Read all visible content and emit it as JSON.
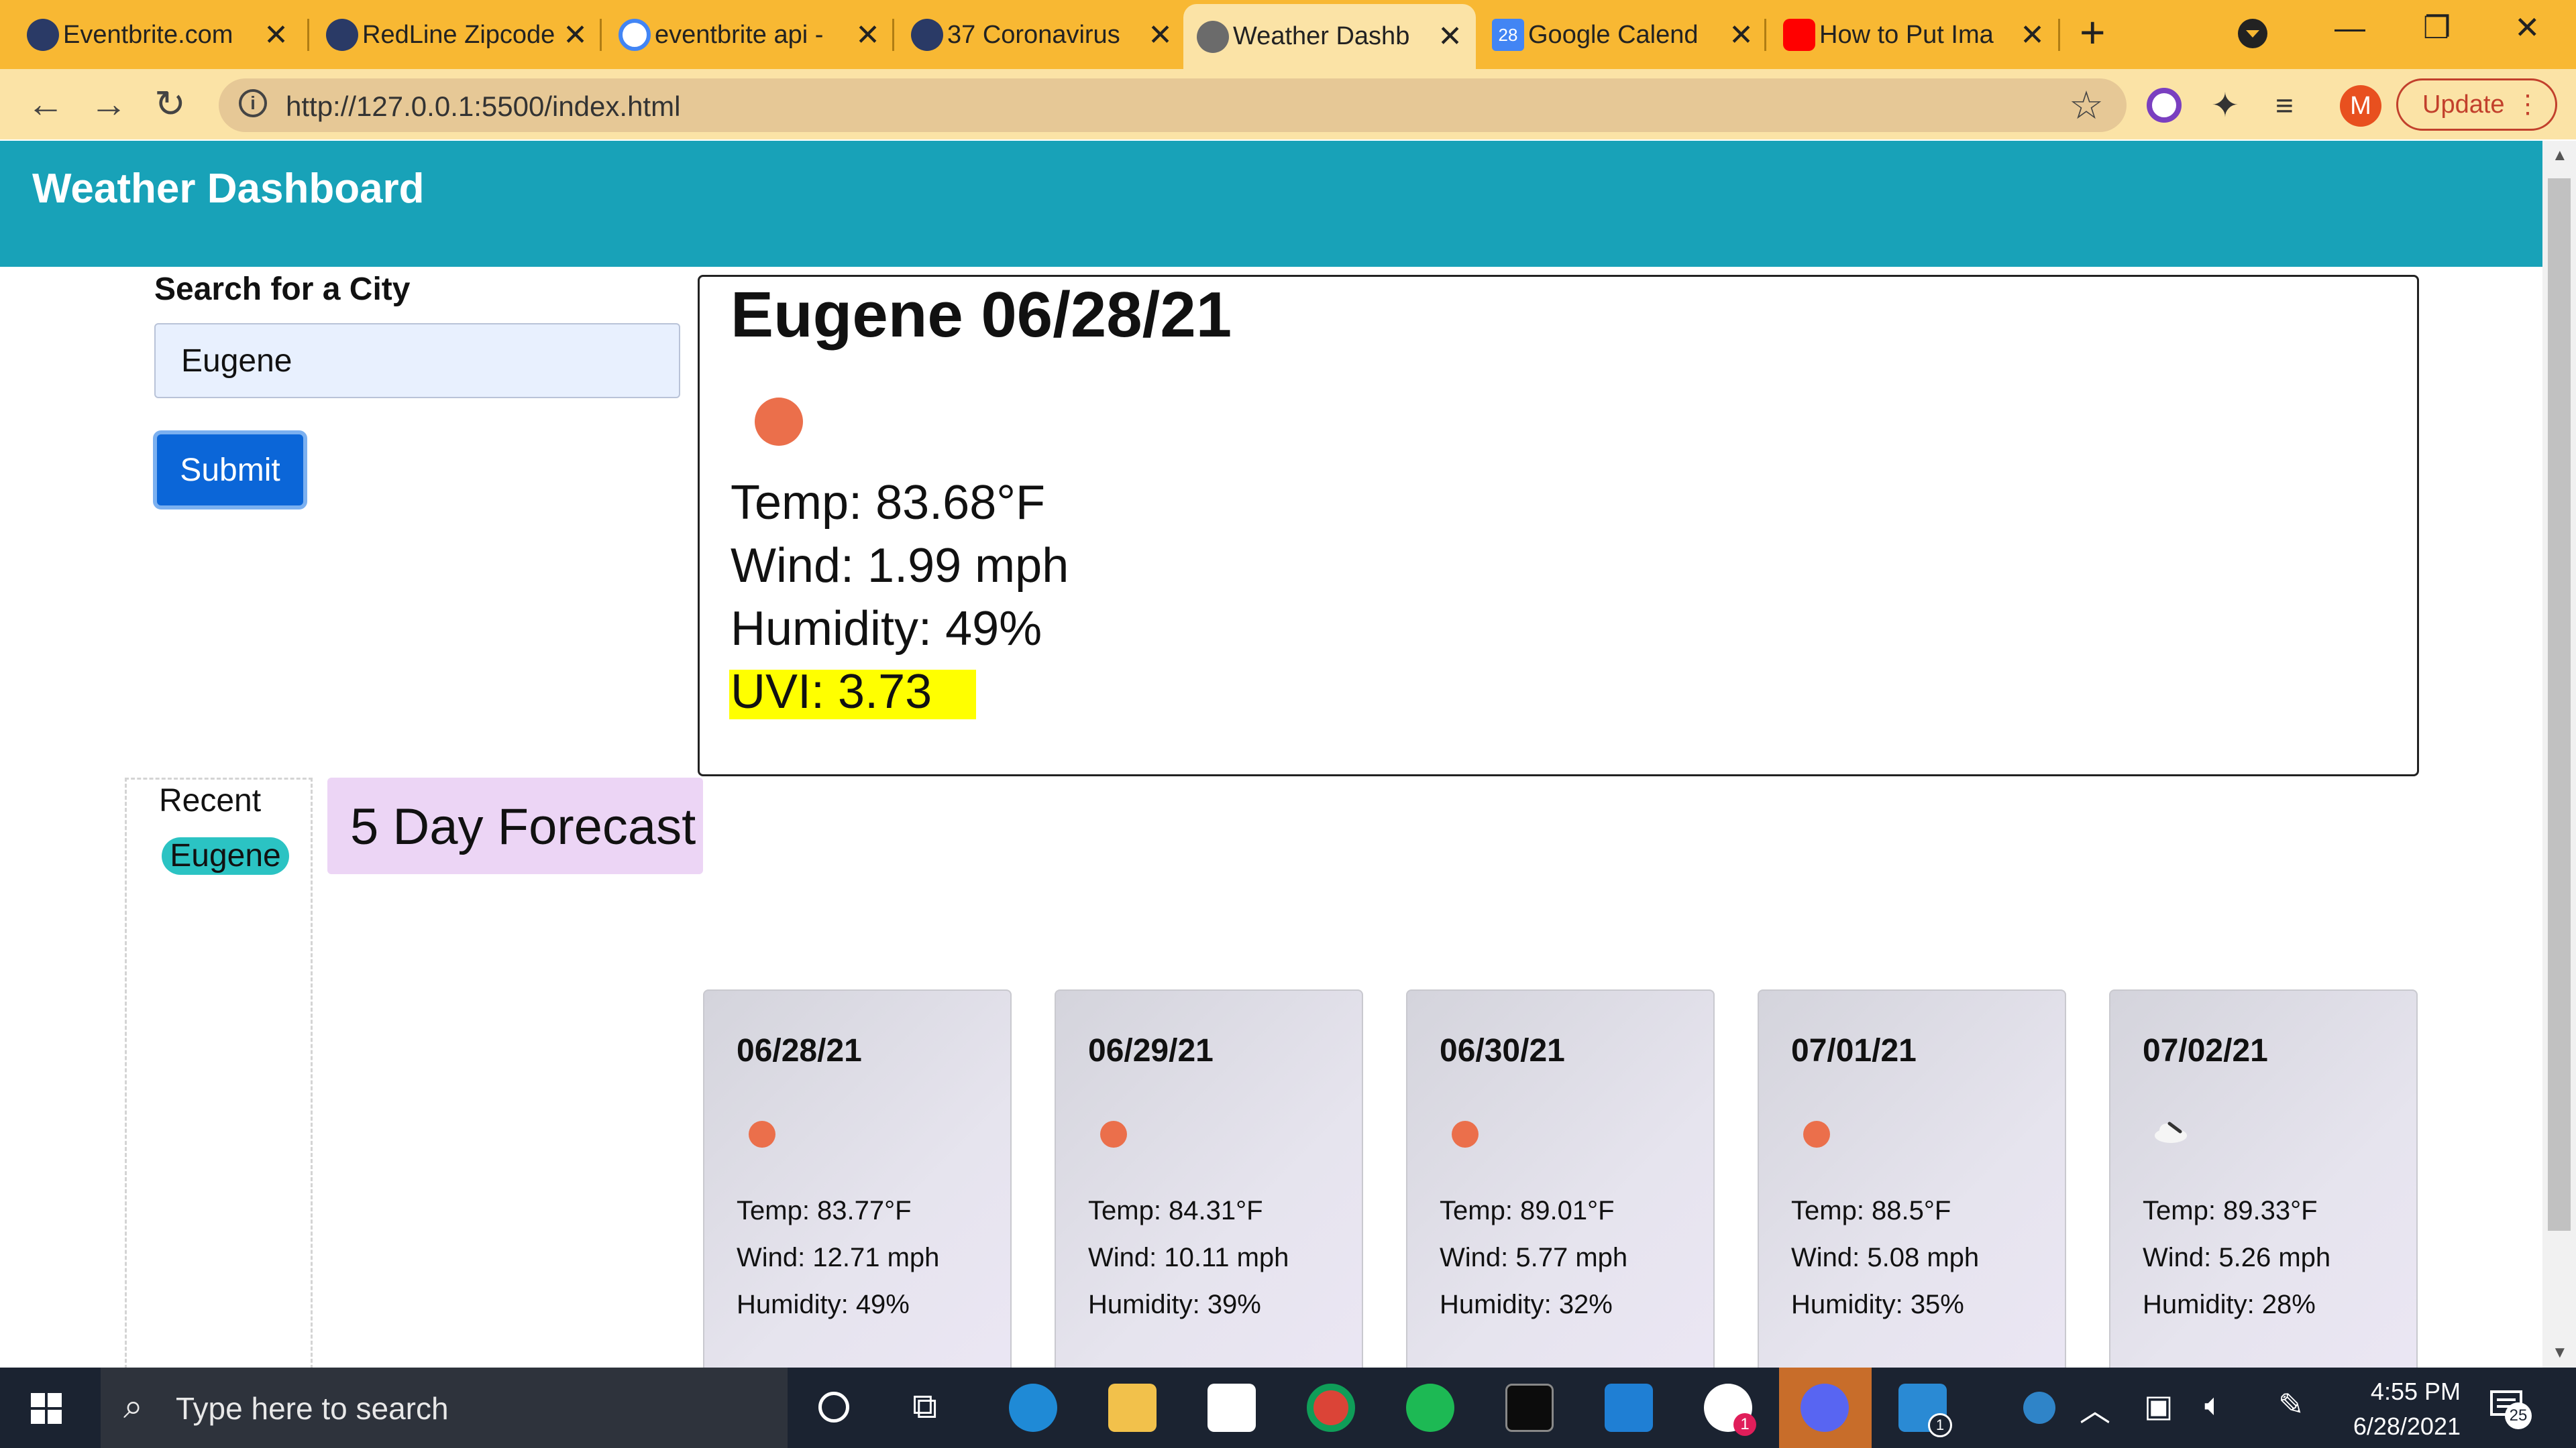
{
  "browser": {
    "tabs": [
      {
        "title": "Eventbrite.com",
        "icon": "person-silhouette-icon",
        "active": false
      },
      {
        "title": "RedLine Zipcode",
        "icon": "person-silhouette-icon",
        "active": false
      },
      {
        "title": "eventbrite api -",
        "icon": "google-icon",
        "active": false
      },
      {
        "title": "37 Coronavirus",
        "icon": "person-silhouette-icon",
        "active": false
      },
      {
        "title": "Weather Dashb",
        "icon": "globe-icon",
        "active": true
      },
      {
        "title": "Google Calend",
        "icon": "calendar-icon",
        "active": false
      },
      {
        "title": "How to Put Ima",
        "icon": "youtube-icon",
        "active": false
      }
    ],
    "new_tab": "+",
    "url": "http://127.0.0.1:5500/index.html",
    "profile_initial": "M",
    "update_label": "Update",
    "calendar_day": "28"
  },
  "app": {
    "title": "Weather Dashboard",
    "search": {
      "label": "Search for a City",
      "value": "Eugene",
      "submit_label": "Submit"
    },
    "current": {
      "heading": "Eugene 06/28/21",
      "icon": "sun-icon",
      "temp": "Temp: 83.68°F",
      "wind": "Wind: 1.99 mph",
      "humidity": "Humidity: 49%",
      "uvi": "UVI: 3.73",
      "uvi_color": "#ffff00"
    },
    "recent": {
      "label": "Recent",
      "items": [
        "Eugene"
      ]
    },
    "forecast_heading": "5 Day Forecast",
    "forecast": [
      {
        "date": "06/28/21",
        "icon": "sun-icon",
        "temp": "Temp: 83.77°F",
        "wind": "Wind: 12.71 mph",
        "humidity": "Humidity: 49%"
      },
      {
        "date": "06/29/21",
        "icon": "sun-icon",
        "temp": "Temp: 84.31°F",
        "wind": "Wind: 10.11 mph",
        "humidity": "Humidity: 39%"
      },
      {
        "date": "06/30/21",
        "icon": "sun-icon",
        "temp": "Temp: 89.01°F",
        "wind": "Wind: 5.77 mph",
        "humidity": "Humidity: 32%"
      },
      {
        "date": "07/01/21",
        "icon": "sun-icon",
        "temp": "Temp: 88.5°F",
        "wind": "Wind: 5.08 mph",
        "humidity": "Humidity: 35%"
      },
      {
        "date": "07/02/21",
        "icon": "cloud-icon",
        "temp": "Temp: 89.33°F",
        "wind": "Wind: 5.26 mph",
        "humidity": "Humidity: 28%"
      }
    ]
  },
  "taskbar": {
    "search_placeholder": "Type here to search",
    "time": "4:55 PM",
    "date": "6/28/2021",
    "notification_count": "25",
    "slack_badge": "1",
    "mail_badge": "1"
  },
  "colors": {
    "tabstrip": "#f8b833",
    "header": "#18a2b8",
    "submit": "#0b66d8",
    "recent_pill": "#2bc3c3",
    "forecast_heading_bg": "#ecd5f5",
    "sun": "#eb6f4b"
  }
}
